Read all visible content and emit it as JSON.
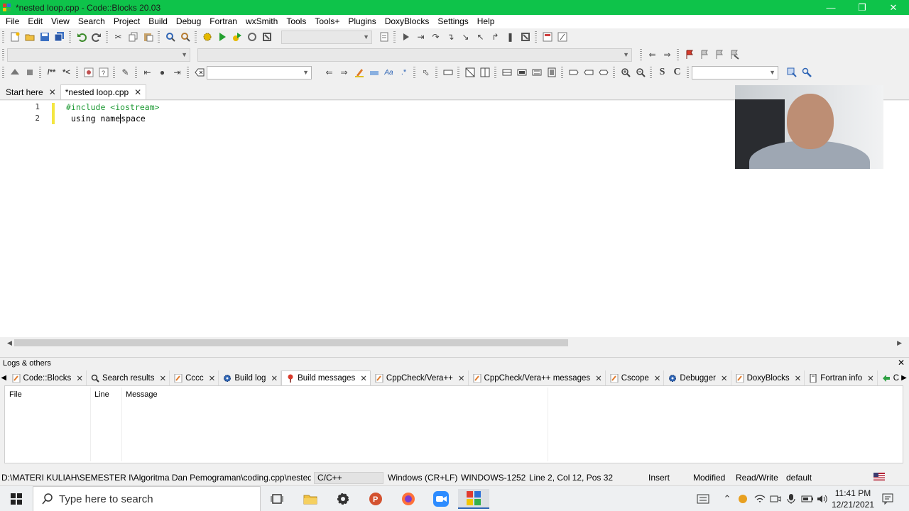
{
  "window": {
    "title": "*nested loop.cpp - Code::Blocks 20.03",
    "colors": {
      "titlebar": "#0ec34a",
      "change_marker": "#f4e641",
      "preprocessor": "#1e9a34"
    }
  },
  "menu": [
    "File",
    "Edit",
    "View",
    "Search",
    "Project",
    "Build",
    "Debug",
    "Fortran",
    "wxSmith",
    "Tools",
    "Tools+",
    "Plugins",
    "DoxyBlocks",
    "Settings",
    "Help"
  ],
  "editor_tabs": [
    {
      "label": "Start here",
      "active": false
    },
    {
      "label": "*nested loop.cpp",
      "active": true
    }
  ],
  "editor": {
    "lines": [
      {
        "number": "1",
        "text": "#include <iostream>"
      },
      {
        "number": "2",
        "text_before_caret": " using name",
        "text_after_caret": "space"
      }
    ]
  },
  "logs": {
    "title": "Logs & others",
    "tabs": [
      {
        "label": "Code::Blocks",
        "icon": "doc-icon"
      },
      {
        "label": "Search results",
        "icon": "search-icon"
      },
      {
        "label": "Cccc",
        "icon": "doc-icon"
      },
      {
        "label": "Build log",
        "icon": "gear-icon"
      },
      {
        "label": "Build messages",
        "icon": "pin-icon",
        "active": true
      },
      {
        "label": "CppCheck/Vera++",
        "icon": "doc-icon"
      },
      {
        "label": "CppCheck/Vera++ messages",
        "icon": "doc-icon"
      },
      {
        "label": "Cscope",
        "icon": "doc-icon"
      },
      {
        "label": "Debugger",
        "icon": "gear-icon"
      },
      {
        "label": "DoxyBlocks",
        "icon": "doc-icon"
      },
      {
        "label": "Fortran info",
        "icon": "page-icon"
      },
      {
        "label": "Clo",
        "icon": "arrow-icon"
      }
    ],
    "columns": [
      "File",
      "Line",
      "Message"
    ]
  },
  "status": {
    "path": "D:\\MATERI KULIAH\\SEMESTER I\\Algoritma Dan Pemograman\\coding.cpp\\nested loop...",
    "language": "C/C++",
    "eol": "Windows (CR+LF)",
    "encoding": "WINDOWS-1252",
    "position": "Line 2, Col 12, Pos 32",
    "mode": "Insert",
    "modified": "Modified",
    "access": "Read/Write",
    "profile": "default"
  },
  "taskbar": {
    "search_placeholder": "Type here to search",
    "time": "11:41 PM",
    "date": "12/21/2021"
  }
}
